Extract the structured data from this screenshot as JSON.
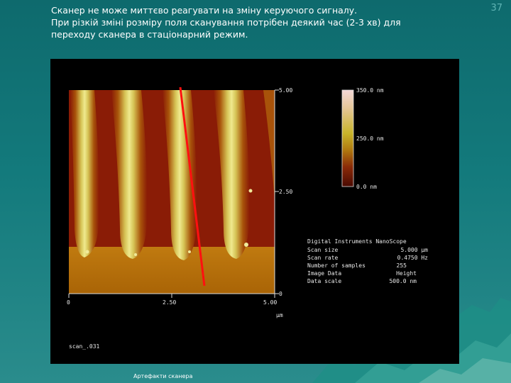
{
  "slide": {
    "page_number": "37",
    "text_lines": [
      "Сканер не може миттєво реагувати на зміну керуючого сигналу.",
      "При різкій зміні розміру поля сканування потрібен деякий час (2-3 хв) для",
      "переходу сканера в стаціонарний режим."
    ],
    "caption": "Артефакти сканера"
  },
  "afm": {
    "y_ticks": [
      "5.00",
      "2.50",
      "0"
    ],
    "x_ticks": [
      "0",
      "2.50",
      "5.00"
    ],
    "x_unit": "µm",
    "colorbar_labels": [
      "350.0 nm",
      "250.0 nm",
      "0.0 nm"
    ],
    "info_title": "Digital Instruments NanoScope",
    "info_rows": [
      {
        "key": "Scan size",
        "value": "5.000 µm"
      },
      {
        "key": "Scan rate",
        "value": "0.4750 Hz"
      },
      {
        "key": "Number of samples",
        "value": "255"
      },
      {
        "key": "Image Data",
        "value": "Height"
      },
      {
        "key": "Data scale",
        "value": "500.0 nm"
      }
    ],
    "filename": "scan_.031",
    "colors": {
      "stripe": "#e2e07a",
      "trough": "#8a1c06",
      "base": "#b36f08",
      "marker_line": "#ff1010"
    }
  }
}
